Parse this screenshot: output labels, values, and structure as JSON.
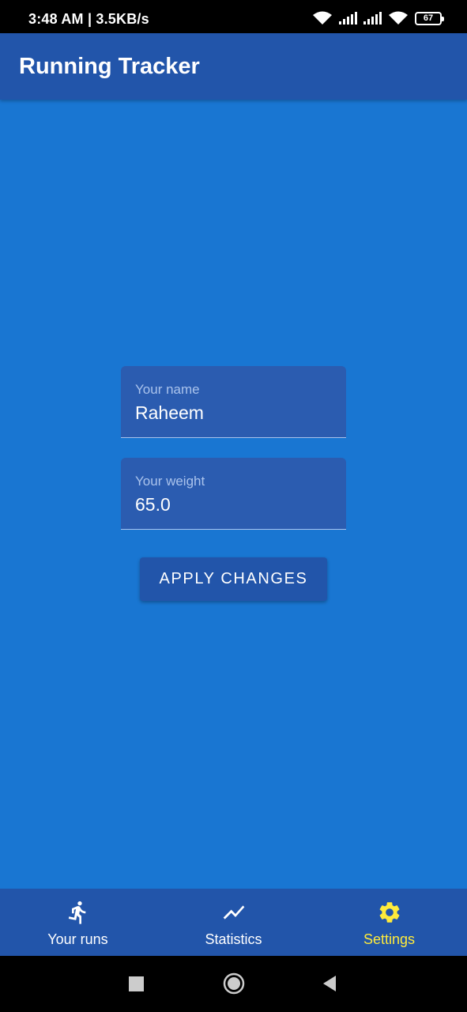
{
  "status_bar": {
    "time": "3:48 AM | 3.5KB/s",
    "battery": "67"
  },
  "app_bar": {
    "title": "Running Tracker"
  },
  "form": {
    "name_label": "Your name",
    "name_value": "Raheem",
    "weight_label": "Your weight",
    "weight_value": "65.0",
    "apply_label": "APPLY CHANGES"
  },
  "bottom_nav": {
    "items": [
      {
        "label": "Your runs",
        "icon": "run-icon"
      },
      {
        "label": "Statistics",
        "icon": "trending-icon"
      },
      {
        "label": "Settings",
        "icon": "gear-icon",
        "active": true
      }
    ]
  },
  "colors": {
    "primary": "#1976d2",
    "primary_dark": "#2255aa",
    "active": "#ffeb3b"
  }
}
